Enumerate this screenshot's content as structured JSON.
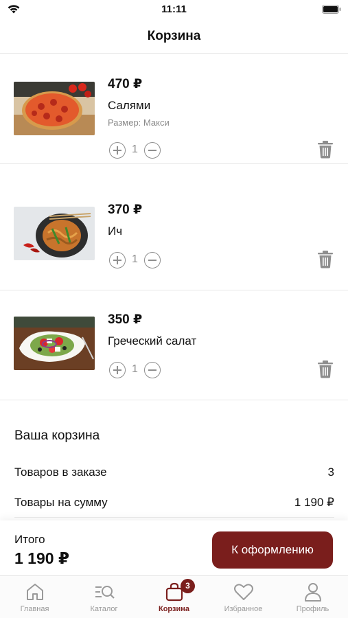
{
  "status_bar": {
    "time": "11:11"
  },
  "header": {
    "title": "Корзина"
  },
  "cart": {
    "items": [
      {
        "price": "470 ₽",
        "name": "Салями",
        "size": "Размер: Макси",
        "quantity": "1",
        "image": "pizza-photo"
      },
      {
        "price": "370 ₽",
        "name": "Ич",
        "quantity": "1",
        "image": "noodles-photo"
      },
      {
        "price": "350 ₽",
        "name": "Греческий салат",
        "quantity": "1",
        "image": "greek-salad-photo"
      }
    ]
  },
  "summary": {
    "title": "Ваша корзина",
    "items_count_label": "Товаров в заказе",
    "items_count_value": "3",
    "items_sum_label": "Товары на сумму",
    "items_sum_value": "1 190 ₽"
  },
  "checkout": {
    "total_label": "Итого",
    "total_value": "1 190 ₽",
    "button_label": "К оформлению"
  },
  "tabbar": {
    "tabs": [
      {
        "label": "Главная",
        "icon": "home-icon"
      },
      {
        "label": "Каталог",
        "icon": "catalog-search-icon"
      },
      {
        "label": "Корзина",
        "icon": "cart-bag-icon",
        "badge": "3",
        "active": true
      },
      {
        "label": "Избранное",
        "icon": "heart-icon"
      },
      {
        "label": "Профиль",
        "icon": "profile-icon"
      }
    ]
  },
  "colors": {
    "accent": "#7a1e1c",
    "muted": "#8e8e8e",
    "divider": "#e8e8e8"
  }
}
